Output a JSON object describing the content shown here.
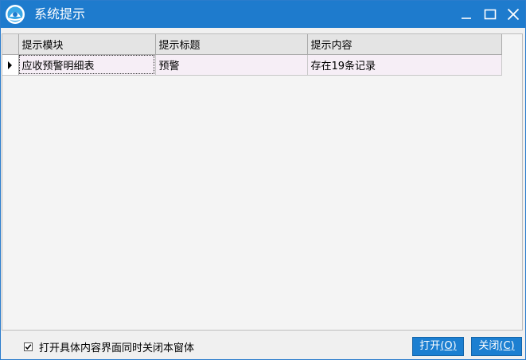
{
  "window": {
    "title": "系统提示"
  },
  "icons": {
    "app": "app-logo-icon",
    "minimize": "minimize-icon",
    "maximize": "maximize-icon",
    "close": "close-icon",
    "row_indicator": "row-pointer-icon",
    "check": "checkmark-icon"
  },
  "colors": {
    "titlebar": "#1e7bcd",
    "button": "#1c7fd1",
    "row_background": "#f6eef6",
    "header_background": "#e4e4e4"
  },
  "grid": {
    "columns": [
      "提示模块",
      "提示标题",
      "提示内容"
    ],
    "rows": [
      [
        "应收预警明细表",
        "预警",
        "存在19条记录"
      ]
    ],
    "selected_row": 0
  },
  "footer": {
    "checkbox_label": "打开具体内容界面同时关闭本窗体",
    "checkbox_checked": true,
    "open_button": {
      "label": "打开",
      "accel": "(O)"
    },
    "close_button": {
      "label": "关闭",
      "accel": "(C)"
    }
  }
}
